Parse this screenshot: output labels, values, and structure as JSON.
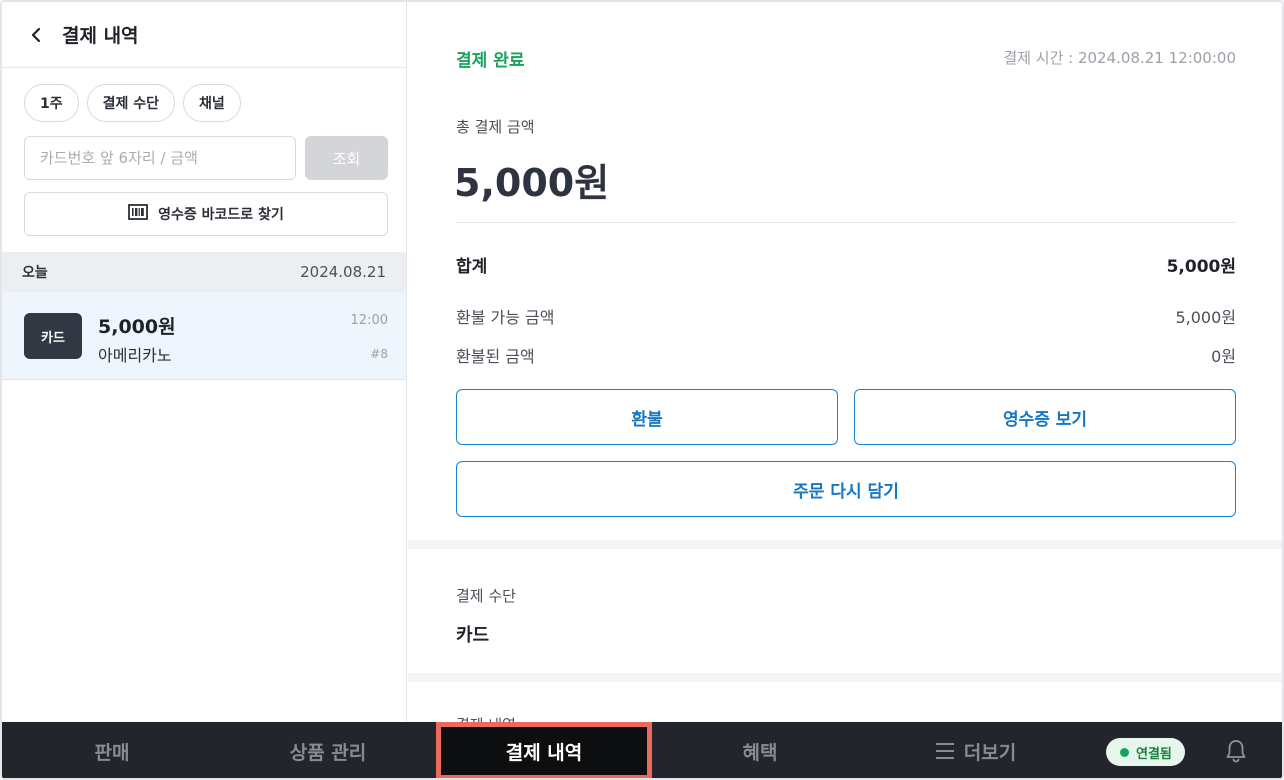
{
  "left_panel": {
    "title": "결제 내역",
    "chips": [
      "1주",
      "결제 수단",
      "채널"
    ],
    "search": {
      "placeholder": "카드번호 앞 6자리 / 금액",
      "button_label": "조회"
    },
    "barcode_button_label": "영수증 바코드로 찾기",
    "date_group": {
      "label": "오늘",
      "date": "2024.08.21"
    },
    "transactions": [
      {
        "badge": "카드",
        "amount": "5,000원",
        "item": "아메리카노",
        "time": "12:00",
        "number": "#8"
      }
    ]
  },
  "detail": {
    "status": "결제 완료",
    "pay_time": "결제 시간 : 2024.08.21 12:00:00",
    "total_label": "총 결제 금액",
    "total_amount": "5,000원",
    "sum_label": "합계",
    "sum_value": "5,000원",
    "refundable_label": "환불 가능 금액",
    "refundable_value": "5,000원",
    "refunded_label": "환불된 금액",
    "refunded_value": "0원",
    "refund_button": "환불",
    "receipt_button": "영수증 보기",
    "reorder_button": "주문 다시 담기",
    "method_label": "결제 수단",
    "method_value": "카드",
    "detail_label": "결제 내역"
  },
  "bottom_nav": {
    "items": [
      "판매",
      "상품 관리",
      "결제 내역",
      "혜택",
      "더보기"
    ],
    "active": "결제 내역",
    "connection_status": "연결됨"
  },
  "colors": {
    "success_green": "#17a35d",
    "accent_blue": "#1a84cf",
    "nav_background": "#22252b",
    "highlight_border": "#ec6a5b"
  }
}
